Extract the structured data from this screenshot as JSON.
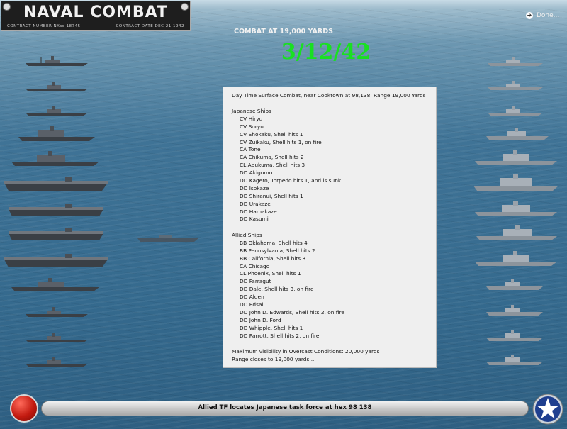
{
  "title": {
    "main": "NAVAL COMBAT",
    "contract_number": "CONTRACT NUMBER   NXss-18745",
    "contract_date": "CONTRACT DATE  DEC 21 1942"
  },
  "done_label": "Done...",
  "range_heading": "COMBAT AT 19,000 YARDS",
  "date": "3/12/42",
  "report": {
    "header": "Day Time Surface Combat, near Cooktown at 98,138, Range 19,000 Yards",
    "japanese_heading": "Japanese Ships",
    "japanese_ships": [
      "CV Hiryu",
      "CV Soryu",
      "CV Shokaku, Shell hits 1",
      "CV Zuikaku, Shell hits 1,  on fire",
      "CA Tone",
      "CA Chikuma, Shell hits 2",
      "CL Abukuma, Shell hits 3",
      "DD Akigumo",
      "DD Kagero, Torpedo hits 1, and is sunk",
      "DD Isokaze",
      "DD Shiranui, Shell hits 1",
      "DD Urakaze",
      "DD Hamakaze",
      "DD Kasumi"
    ],
    "allied_heading": "Allied Ships",
    "allied_ships": [
      "BB Oklahoma, Shell hits 4",
      "BB Pennsylvania, Shell hits 2",
      "BB California, Shell hits 3",
      "CA Chicago",
      "CL Phoenix, Shell hits 1",
      "DD Farragut",
      "DD Dale, Shell hits 3,  on fire",
      "DD Alden",
      "DD Edsall",
      "DD John D. Edwards, Shell hits 2,  on fire",
      "DD John D. Ford",
      "DD Whipple, Shell hits 1",
      "DD Parrott, Shell hits 2,  on fire"
    ],
    "footer": [
      "Maximum visibility in Overcast Conditions: 20,000 yards",
      "Range closes to 19,000 yards..."
    ]
  },
  "status_message": "Allied TF locates Japanese task force at hex 98 138",
  "colors": {
    "date_green": "#19e021",
    "report_bg": "#efefef",
    "sea": "#356a8e"
  },
  "icons": {
    "done": "arrow-right-circle-icon",
    "red_button": "red-fire-button",
    "star_button": "star-roundel-icon"
  }
}
